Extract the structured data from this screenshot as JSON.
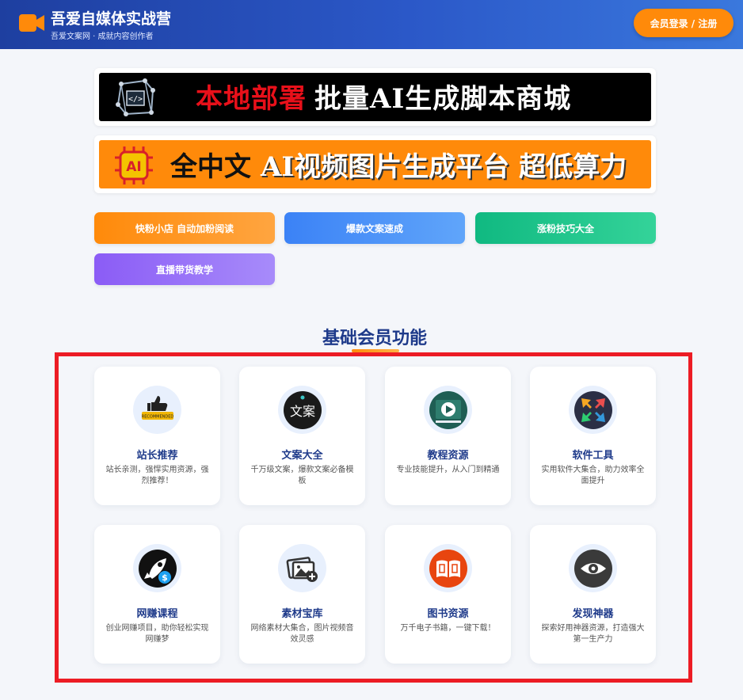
{
  "header": {
    "brand_title": "吾爱自媒体实战营",
    "brand_subtitle": "吾爱文案网 · 成就内容创作者",
    "login_label": "会员登录 / 注册",
    "logo_icon": "video-camera-icon",
    "accent": "#ff8a0a"
  },
  "banners": [
    {
      "part1": "本地部署",
      "part2": "批量AI生成脚本商城",
      "icon": "code-cube-icon"
    },
    {
      "part1": "全中文",
      "part2": "AI视频图片生成平台 超低算力",
      "icon": "ai-chip-icon"
    }
  ],
  "quick_links": [
    {
      "label": "快粉小店 自动加粉阅读"
    },
    {
      "label": "爆款文案速成"
    },
    {
      "label": "涨粉技巧大全"
    },
    {
      "label": "直播带货教学"
    }
  ],
  "section": {
    "title": "基础会员功能"
  },
  "cards": [
    {
      "title": "站长推荐",
      "desc": "站长亲测，强悍实用资源，强烈推荐！",
      "icon": "thumbs-up-icon"
    },
    {
      "title": "文案大全",
      "desc": "千万级文案，爆款文案必备模板",
      "icon": "wenan-text-icon"
    },
    {
      "title": "教程资源",
      "desc": "专业技能提升，从入门到精通",
      "icon": "play-board-icon"
    },
    {
      "title": "软件工具",
      "desc": "实用软件大集合，助力效率全面提升",
      "icon": "arrows-in-icon"
    },
    {
      "title": "网赚课程",
      "desc": "创业网赚项目，助你轻松实现网赚梦",
      "icon": "rocket-dollar-icon"
    },
    {
      "title": "素材宝库",
      "desc": "网络素材大集合，图片视频音效灵感",
      "icon": "image-add-icon"
    },
    {
      "title": "图书资源",
      "desc": "万千电子书籍，一键下载！",
      "icon": "open-book-icon"
    },
    {
      "title": "发现神器",
      "desc": "探索好用神器资源，打造强大第一生产力",
      "icon": "eye-icon"
    }
  ]
}
